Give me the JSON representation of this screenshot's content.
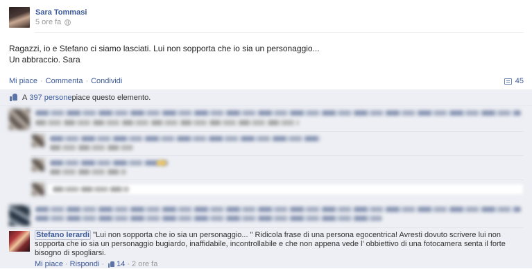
{
  "post": {
    "author": "Sara Tommasi",
    "time": "5 ore fa",
    "message_line1": "Ragazzi, io e Stefano ci siamo lasciati. Lui non sopporta che io sia un personaggio...",
    "message_line2": "Un abbraccio. Sara"
  },
  "actions": {
    "like": "Mi piace",
    "comment": "Commenta",
    "share": "Condividi",
    "separator": "·",
    "comment_count": "45"
  },
  "likes": {
    "prefix": "A ",
    "people": "397 persone",
    "suffix": " piace questo elemento."
  },
  "comment": {
    "author": "Stefano Ierardi",
    "text": "\"Lui non sopporta che io sia un personaggio... \" Ridicola frase di una persona egocentrica! Avresti dovuto scrivere lui non sopporta che io sia un personaggio bugiardo, inaffidabile, incontrollabile e che non appena vede l' obbiettivo di una fotocamera senta il forte bisogno di spogliarsi.",
    "like": "Mi piace",
    "reply": "Rispondi",
    "separator": "·",
    "like_count": "14",
    "time": "2 ore fa"
  },
  "icons": {
    "globe": "globe-icon",
    "comment": "comment-bubble-icon",
    "thumb": "thumbs-up-icon"
  },
  "colors": {
    "link": "#3b5998",
    "ufi_bg": "#edeff4",
    "meta_grey": "#999999"
  }
}
